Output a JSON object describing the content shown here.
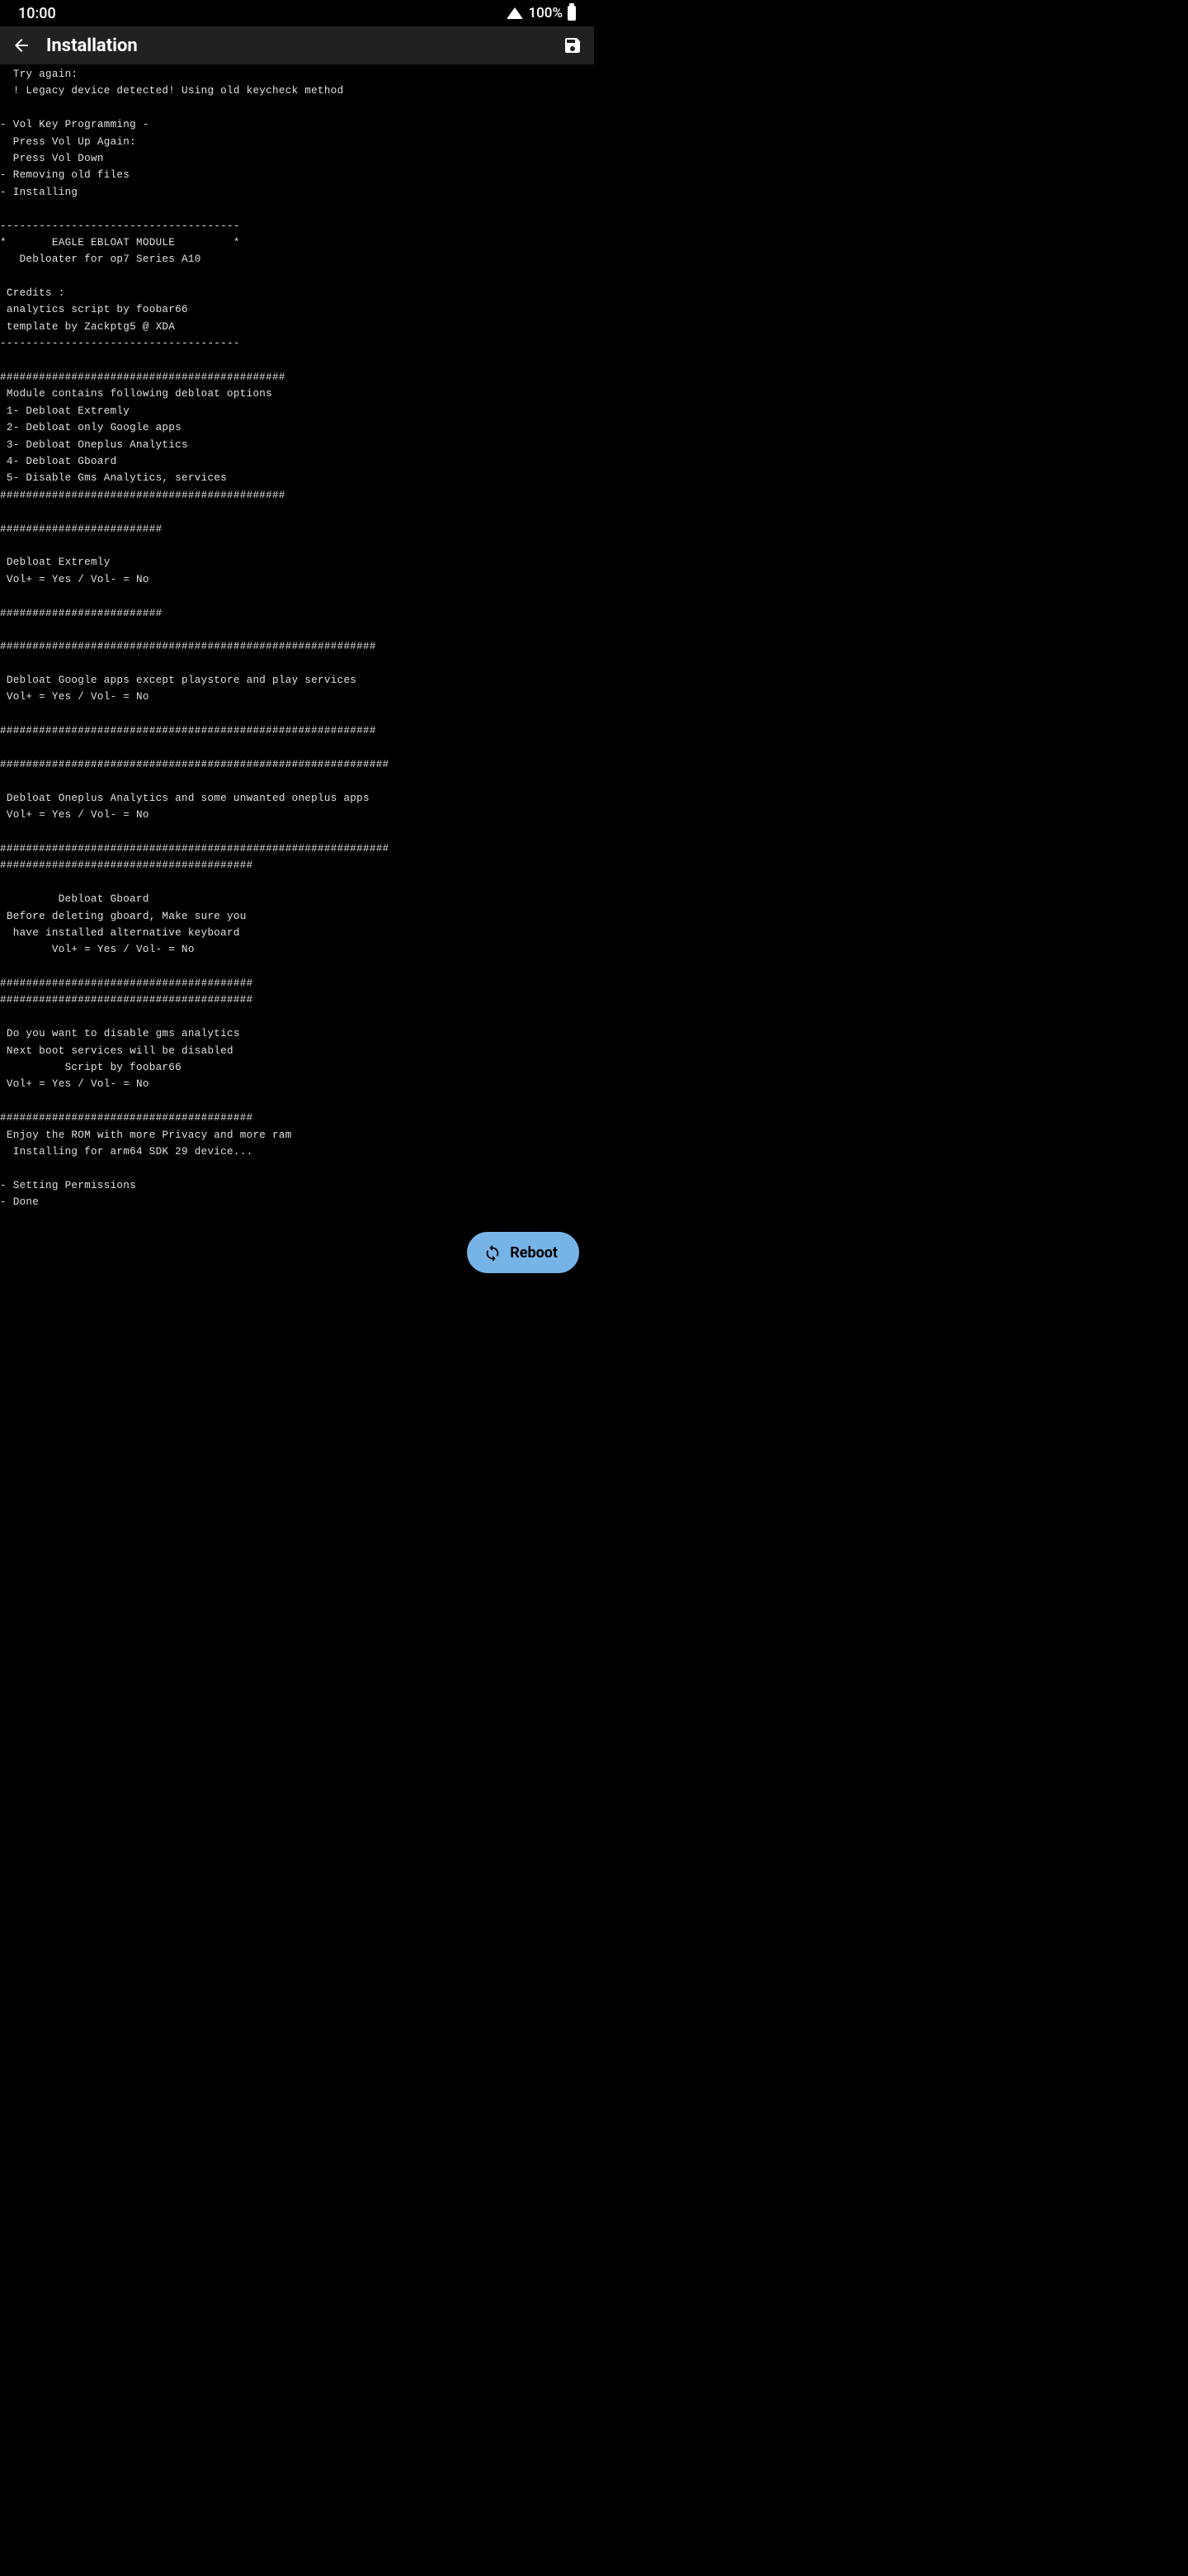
{
  "status": {
    "time": "10:00",
    "battery": "100%"
  },
  "header": {
    "title": "Installation"
  },
  "terminal": {
    "text": "  Try again:\n  ! Legacy device detected! Using old keycheck method\n\n- Vol Key Programming -\n  Press Vol Up Again:\n  Press Vol Down\n- Removing old files\n- Installing\n\n-------------------------------------\n*       EAGLE EBLOAT MODULE         *\n   Debloater for op7 Series A10\n\n Credits :\n analytics script by foobar66\n template by Zackptg5 @ XDA\n-------------------------------------\n\n############################################\n Module contains following debloat options\n 1- Debloat Extremly\n 2- Debloat only Google apps\n 3- Debloat Oneplus Analytics\n 4- Debloat Gboard\n 5- Disable Gms Analytics, services\n############################################\n\n#########################\n\n Debloat Extremly\n Vol+ = Yes / Vol- = No\n\n#########################\n\n##########################################################\n\n Debloat Google apps except playstore and play services\n Vol+ = Yes / Vol- = No\n\n##########################################################\n\n############################################################\n\n Debloat Oneplus Analytics and some unwanted oneplus apps\n Vol+ = Yes / Vol- = No\n\n############################################################\n#######################################\n\n         Debloat Gboard\n Before deleting gboard, Make sure you\n  have installed alternative keyboard\n        Vol+ = Yes / Vol- = No\n\n#######################################\n#######################################\n\n Do you want to disable gms analytics\n Next boot services will be disabled\n          Script by foobar66\n Vol+ = Yes / Vol- = No\n\n#######################################\n Enjoy the ROM with more Privacy and more ram\n  Installing for arm64 SDK 29 device...\n\n- Setting Permissions\n- Done"
  },
  "fab": {
    "label": "Reboot"
  }
}
